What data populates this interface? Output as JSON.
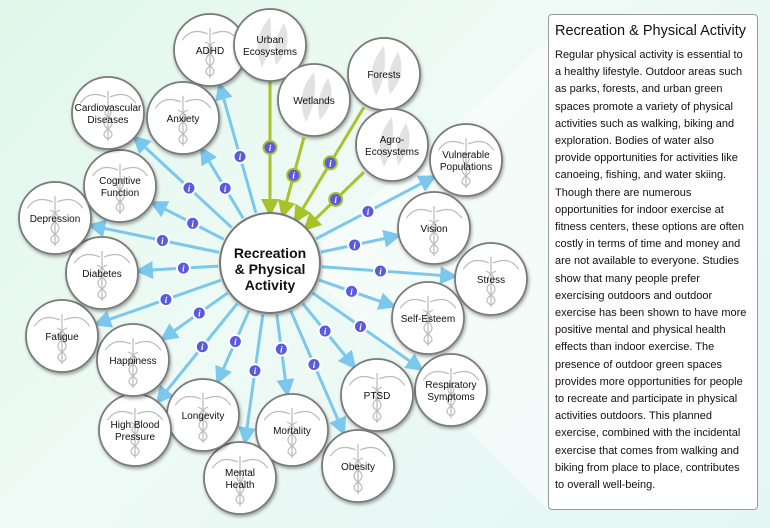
{
  "center": {
    "label_lines": [
      "Recreation",
      "& Physical",
      "Activity"
    ]
  },
  "ecosystems": [
    {
      "id": "urban-ecosystems",
      "lines": [
        "Urban",
        "Ecosystems"
      ]
    },
    {
      "id": "wetlands",
      "lines": [
        "Wetlands"
      ]
    },
    {
      "id": "forests",
      "lines": [
        "Forests"
      ]
    },
    {
      "id": "agro-ecosystems",
      "lines": [
        "Agro-",
        "Ecosystems"
      ]
    }
  ],
  "outcomes": [
    {
      "id": "adhd",
      "lines": [
        "ADHD"
      ]
    },
    {
      "id": "vulnerable-populations",
      "lines": [
        "Vulnerable",
        "Populations"
      ]
    },
    {
      "id": "vision",
      "lines": [
        "Vision"
      ]
    },
    {
      "id": "stress",
      "lines": [
        "Stress"
      ]
    },
    {
      "id": "self-esteem",
      "lines": [
        "Self-Esteem"
      ]
    },
    {
      "id": "respiratory-symptoms",
      "lines": [
        "Respiratory",
        "Symptoms"
      ]
    },
    {
      "id": "ptsd",
      "lines": [
        "PTSD"
      ]
    },
    {
      "id": "obesity",
      "lines": [
        "Obesity"
      ]
    },
    {
      "id": "mortality",
      "lines": [
        "Mortality"
      ]
    },
    {
      "id": "mental-health",
      "lines": [
        "Mental",
        "Health"
      ]
    },
    {
      "id": "longevity",
      "lines": [
        "Longevity"
      ]
    },
    {
      "id": "high-blood-pressure",
      "lines": [
        "High Blood",
        "Pressure"
      ]
    },
    {
      "id": "happiness",
      "lines": [
        "Happiness"
      ]
    },
    {
      "id": "fatigue",
      "lines": [
        "Fatigue"
      ]
    },
    {
      "id": "diabetes",
      "lines": [
        "Diabetes"
      ]
    },
    {
      "id": "depression",
      "lines": [
        "Depression"
      ]
    },
    {
      "id": "cognitive-function",
      "lines": [
        "Cognitive",
        "Function"
      ]
    },
    {
      "id": "cardiovascular-diseases",
      "lines": [
        "Cardiovascular",
        "Diseases"
      ]
    },
    {
      "id": "anxiety",
      "lines": [
        "Anxiety"
      ]
    }
  ],
  "info_icon_label": "i",
  "panel": {
    "title": "Recreation & Physical Activity",
    "body": "Regular physical activity is essential to a healthy lifestyle. Outdoor areas such as parks, forests, and urban green spaces promote a variety of physical activities such as walking, biking and exploration. Bodies of water also provide opportunities for activities like canoeing, fishing, and water skiing. Though there are numerous opportunities for indoor exercise at fitness centers, these options are often costly in terms of time and money and are not available to everyone. Studies show that many people prefer exercising outdoors and outdoor exercise has been shown to have more positive mental and physical health effects than indoor exercise. The presence of outdoor green spaces provides more opportunities for people to recreate and participate in physical activities outdoors. This planned exercise, combined with the incidental exercise that comes from walking and biking from place to place, contributes to overall well-being."
  },
  "colors": {
    "outcome_arrow": "#7cc8ec",
    "ecosystem_arrow": "#a9c22a",
    "info_icon": "#5a5ae0",
    "node_border": "#7a7a7a"
  }
}
